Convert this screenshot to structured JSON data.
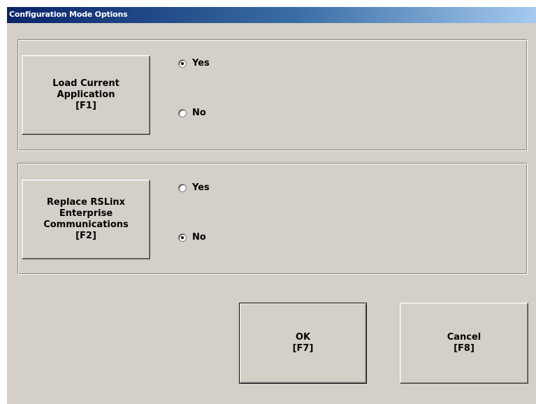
{
  "window": {
    "title": "Configuration Mode Options"
  },
  "load_app": {
    "button_label": "Load Current\nApplication\n[F1]",
    "options": [
      {
        "label": "Yes",
        "selected": true
      },
      {
        "label": "No",
        "selected": false
      }
    ]
  },
  "replace_rslinx": {
    "button_label": "Replace RSLinx\nEnterprise\nCommunications\n[F2]",
    "options": [
      {
        "label": "Yes",
        "selected": false
      },
      {
        "label": "No",
        "selected": true
      }
    ]
  },
  "actions": {
    "ok_label": "OK\n[F7]",
    "cancel_label": "Cancel\n[F8]"
  }
}
